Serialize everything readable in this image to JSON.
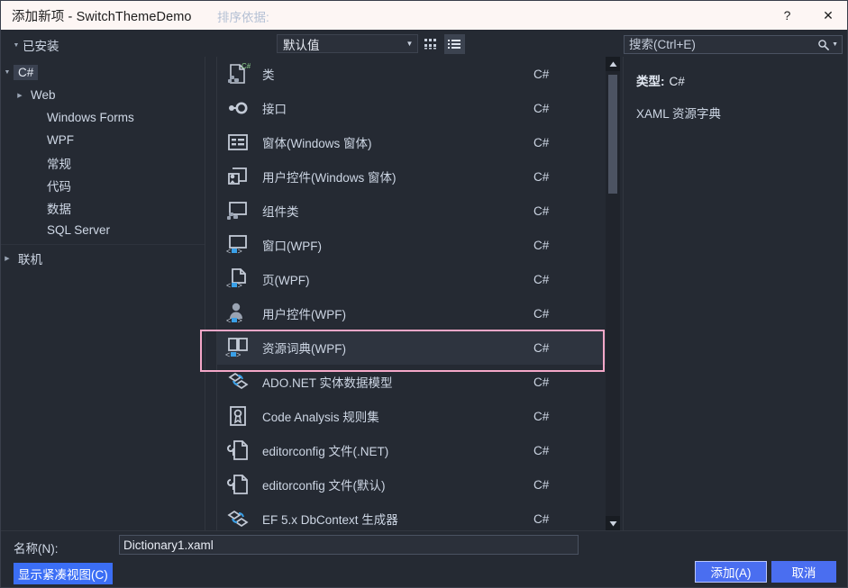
{
  "window": {
    "title": "添加新项 - SwitchThemeDemo",
    "help_label": "?",
    "close_label": "✕"
  },
  "header": {
    "sort_label": "排序依据:",
    "sort_value": "默认值",
    "tile_view_icon": "grid-view-icon",
    "list_view_icon": "list-view-icon",
    "search_placeholder": "搜索(Ctrl+E)",
    "search_value": "",
    "search_icon": "search-icon",
    "search_caret": "▾"
  },
  "sidebar": {
    "installed": {
      "label": "已安装",
      "expander": "▴"
    },
    "online": {
      "label": "联机",
      "expander": "▸"
    },
    "nodes": [
      {
        "label": "C#",
        "expander": "▴",
        "indent": 10,
        "selected": true
      },
      {
        "label": "Web",
        "expander": "▸",
        "indent": 28,
        "selected": false
      },
      {
        "label": "Windows Forms",
        "expander": "",
        "indent": 46,
        "selected": false
      },
      {
        "label": "WPF",
        "expander": "",
        "indent": 46,
        "selected": false
      },
      {
        "label": "常规",
        "expander": "",
        "indent": 46,
        "selected": false
      },
      {
        "label": "代码",
        "expander": "",
        "indent": 46,
        "selected": false
      },
      {
        "label": "数据",
        "expander": "",
        "indent": 46,
        "selected": false
      },
      {
        "label": "SQL Server",
        "expander": "",
        "indent": 46,
        "selected": false
      }
    ]
  },
  "items": [
    {
      "name": "类",
      "lang": "C#",
      "icon": "class-file-icon",
      "selected": false
    },
    {
      "name": "接口",
      "lang": "C#",
      "icon": "interface-icon",
      "selected": false
    },
    {
      "name": "窗体(Windows 窗体)",
      "lang": "C#",
      "icon": "winforms-form-icon",
      "selected": false
    },
    {
      "name": "用户控件(Windows 窗体)",
      "lang": "C#",
      "icon": "winforms-usercontrol-icon",
      "selected": false
    },
    {
      "name": "组件类",
      "lang": "C#",
      "icon": "component-class-icon",
      "selected": false
    },
    {
      "name": "窗口(WPF)",
      "lang": "C#",
      "icon": "wpf-window-icon",
      "selected": false
    },
    {
      "name": "页(WPF)",
      "lang": "C#",
      "icon": "wpf-page-icon",
      "selected": false
    },
    {
      "name": "用户控件(WPF)",
      "lang": "C#",
      "icon": "wpf-usercontrol-icon",
      "selected": false
    },
    {
      "name": "资源词典(WPF)",
      "lang": "C#",
      "icon": "resource-dictionary-icon",
      "selected": true
    },
    {
      "name": "ADO.NET 实体数据模型",
      "lang": "C#",
      "icon": "ado-net-model-icon",
      "selected": false
    },
    {
      "name": "Code Analysis 规则集",
      "lang": "C#",
      "icon": "ruleset-icon",
      "selected": false
    },
    {
      "name": "editorconfig 文件(.NET)",
      "lang": "C#",
      "icon": "editorconfig-icon",
      "selected": false
    },
    {
      "name": "editorconfig 文件(默认)",
      "lang": "C#",
      "icon": "editorconfig-icon",
      "selected": false
    },
    {
      "name": "EF 5.x DbContext 生成器",
      "lang": "C#",
      "icon": "ef-dbcontext-icon",
      "selected": false
    }
  ],
  "scrollbar": {
    "up_arrow": "▲",
    "down_arrow": "▼"
  },
  "detail": {
    "type_label": "类型:",
    "type_value": "C#",
    "description": "XAML 资源字典"
  },
  "footer": {
    "name_label": "名称(N):",
    "name_value": "Dictionary1.xaml",
    "compact_view_label": "显示紧凑视图(C)",
    "add_label": "添加(A)",
    "cancel_label": "取消"
  },
  "colors": {
    "dialog_bg": "#252a33",
    "titlebar_bg": "#fdf6f4",
    "accent_blue": "#4a6ef0",
    "annotation_pink": "#f4a7c8",
    "selection_bg": "#2e343f"
  }
}
